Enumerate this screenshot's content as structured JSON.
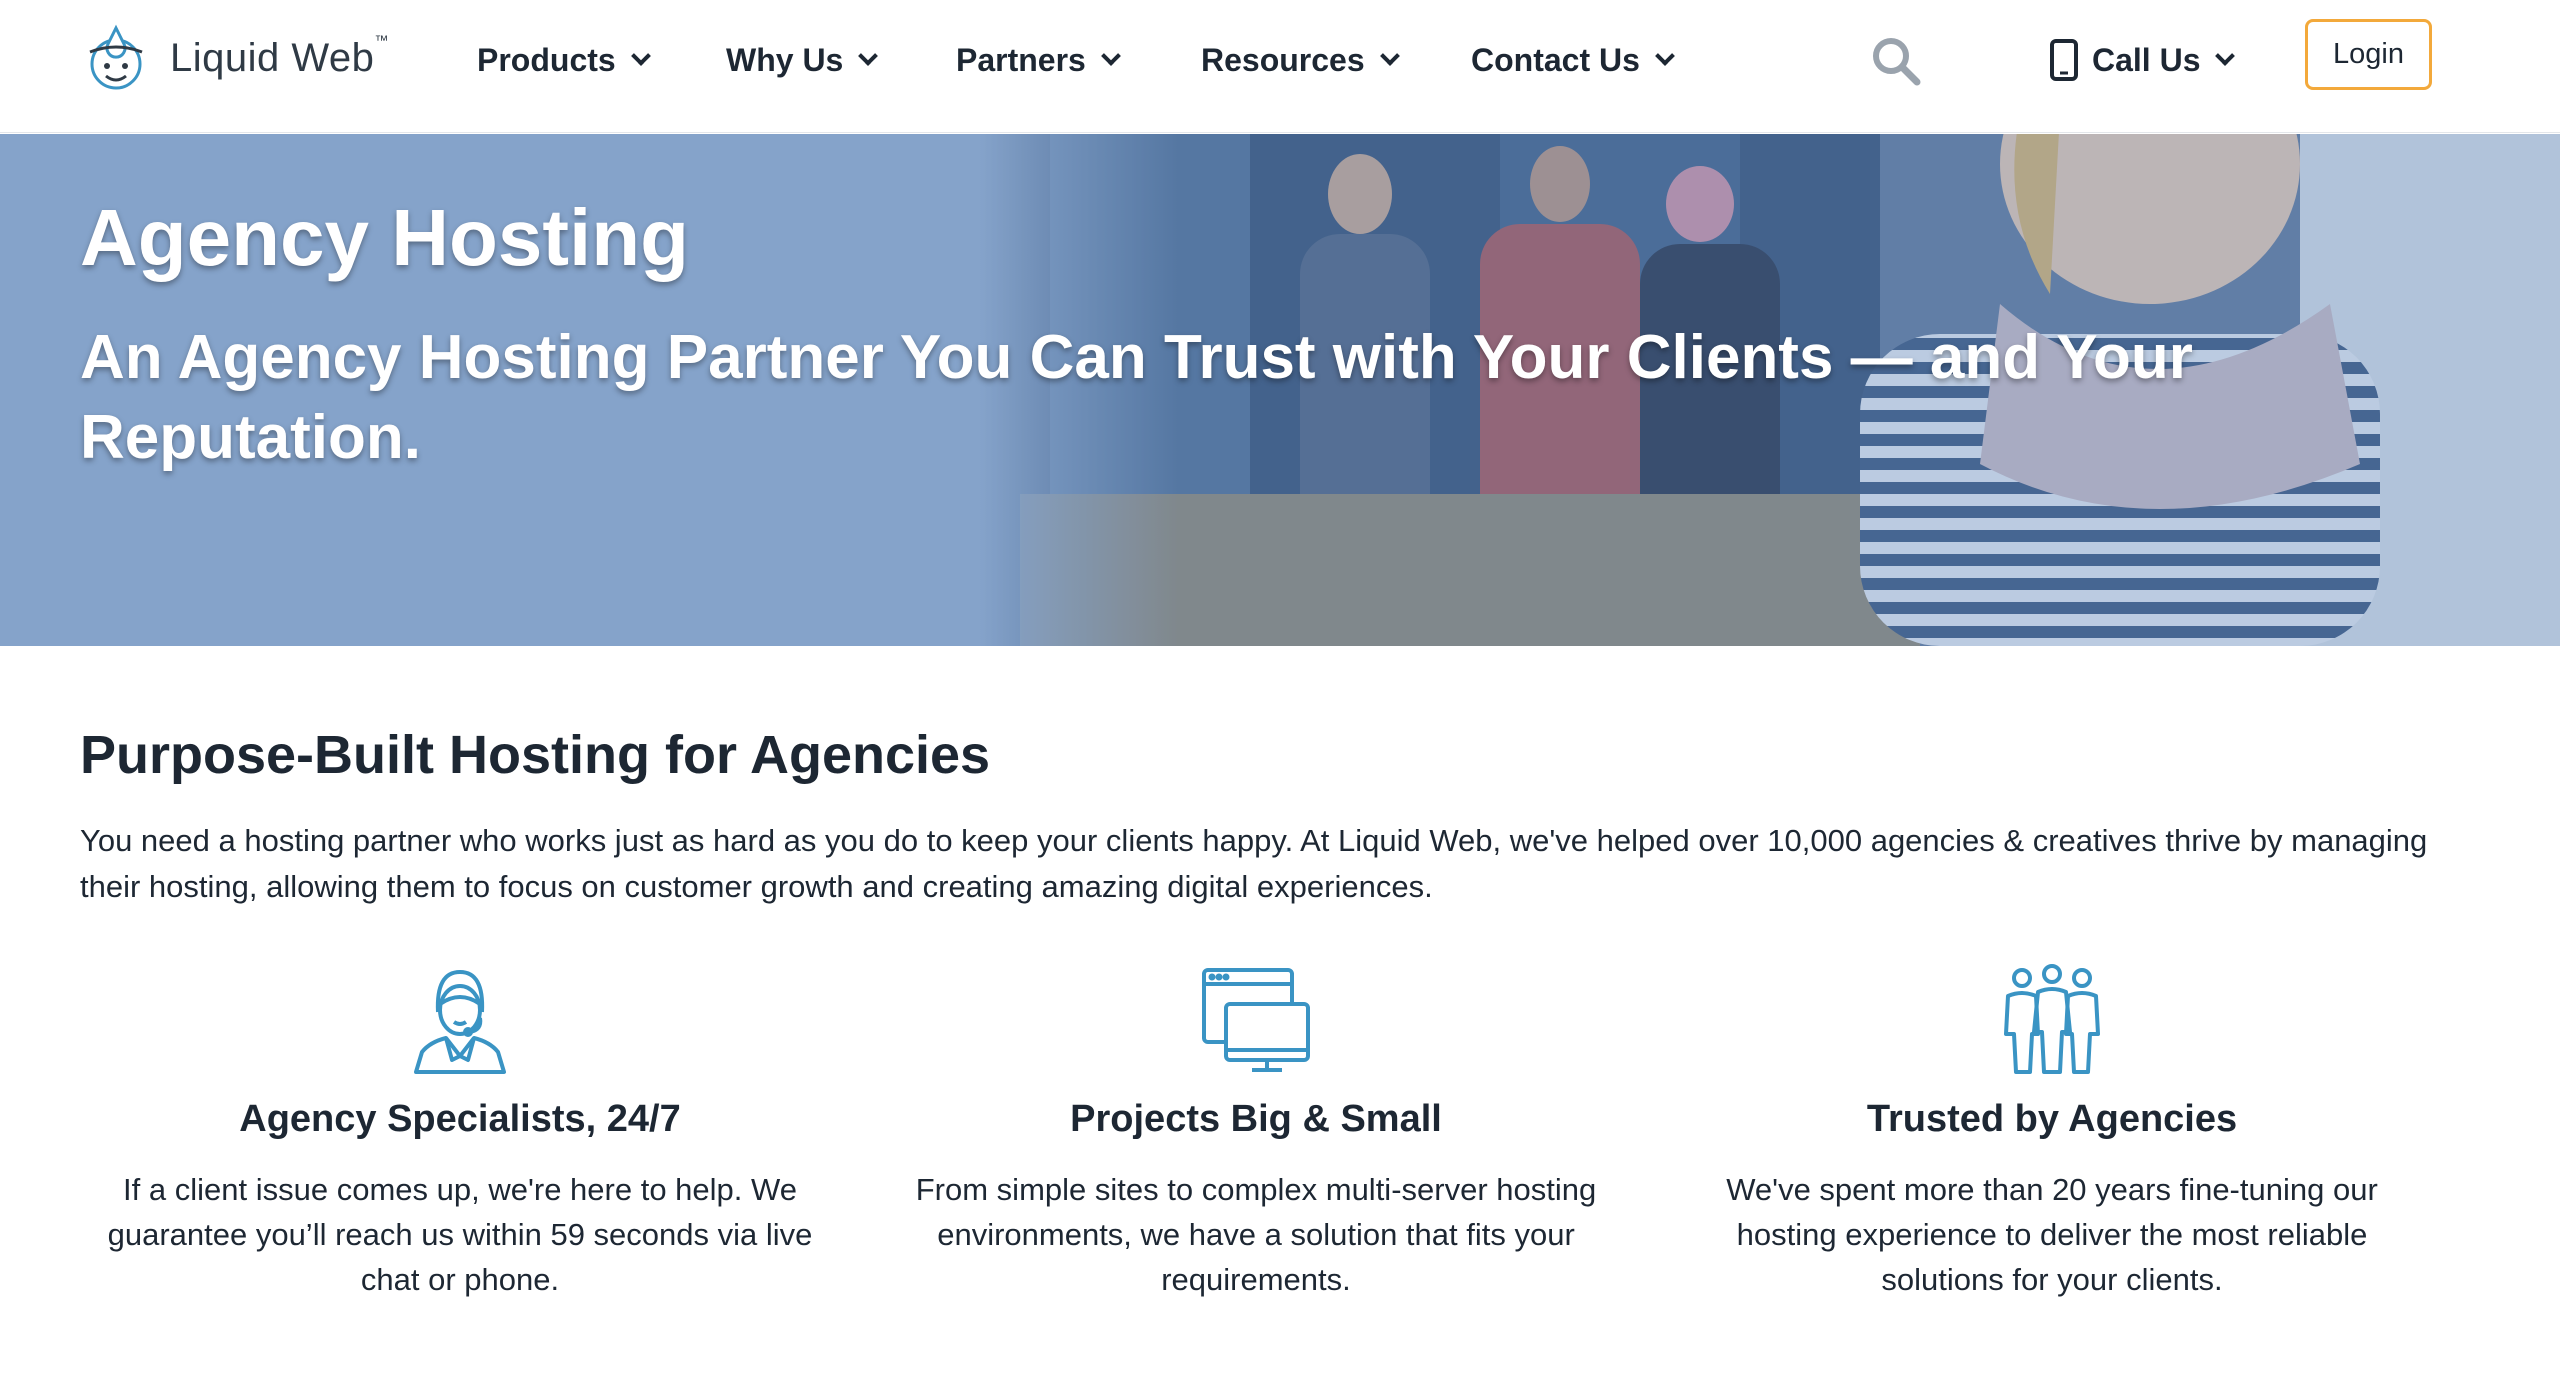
{
  "brand": {
    "name": "Liquid Web",
    "trademark": "™"
  },
  "nav": {
    "items": [
      {
        "label": "Products"
      },
      {
        "label": "Why Us"
      },
      {
        "label": "Partners"
      },
      {
        "label": "Resources"
      },
      {
        "label": "Contact Us"
      }
    ],
    "call_label": "Call Us",
    "login_label": "Login"
  },
  "hero": {
    "title": "Agency Hosting",
    "subtitle": "An Agency Hosting Partner You Can Trust with Your Clients — and Your Reputation."
  },
  "intro": {
    "title": "Purpose-Built Hosting for Agencies",
    "text": "You need a hosting partner who works just as hard as you do to keep your clients happy. At Liquid Web, we've helped over 10,000 agencies & creatives thrive by managing their hosting, allowing them to focus on customer growth and creating amazing digital experiences."
  },
  "features": [
    {
      "icon": "support-agent-icon",
      "title": "Agency Specialists, 24/7",
      "text": "If a client issue comes up, we're here to help. We guarantee you’ll reach us within 59 seconds via live chat or phone."
    },
    {
      "icon": "browser-monitor-icon",
      "title": "Projects Big & Small",
      "text": "From simple sites to complex multi-server hosting environments, we have a solution that fits your requirements."
    },
    {
      "icon": "team-people-icon",
      "title": "Trusted by Agencies",
      "text": "We've spent more than 20 years fine-tuning our hosting experience to deliver the most reliable solutions for your clients."
    }
  ],
  "colors": {
    "accent_blue": "#3a94c4",
    "login_border": "#f3a93b",
    "hero_overlay": "#94aed0",
    "text_dark": "#1d2733"
  }
}
